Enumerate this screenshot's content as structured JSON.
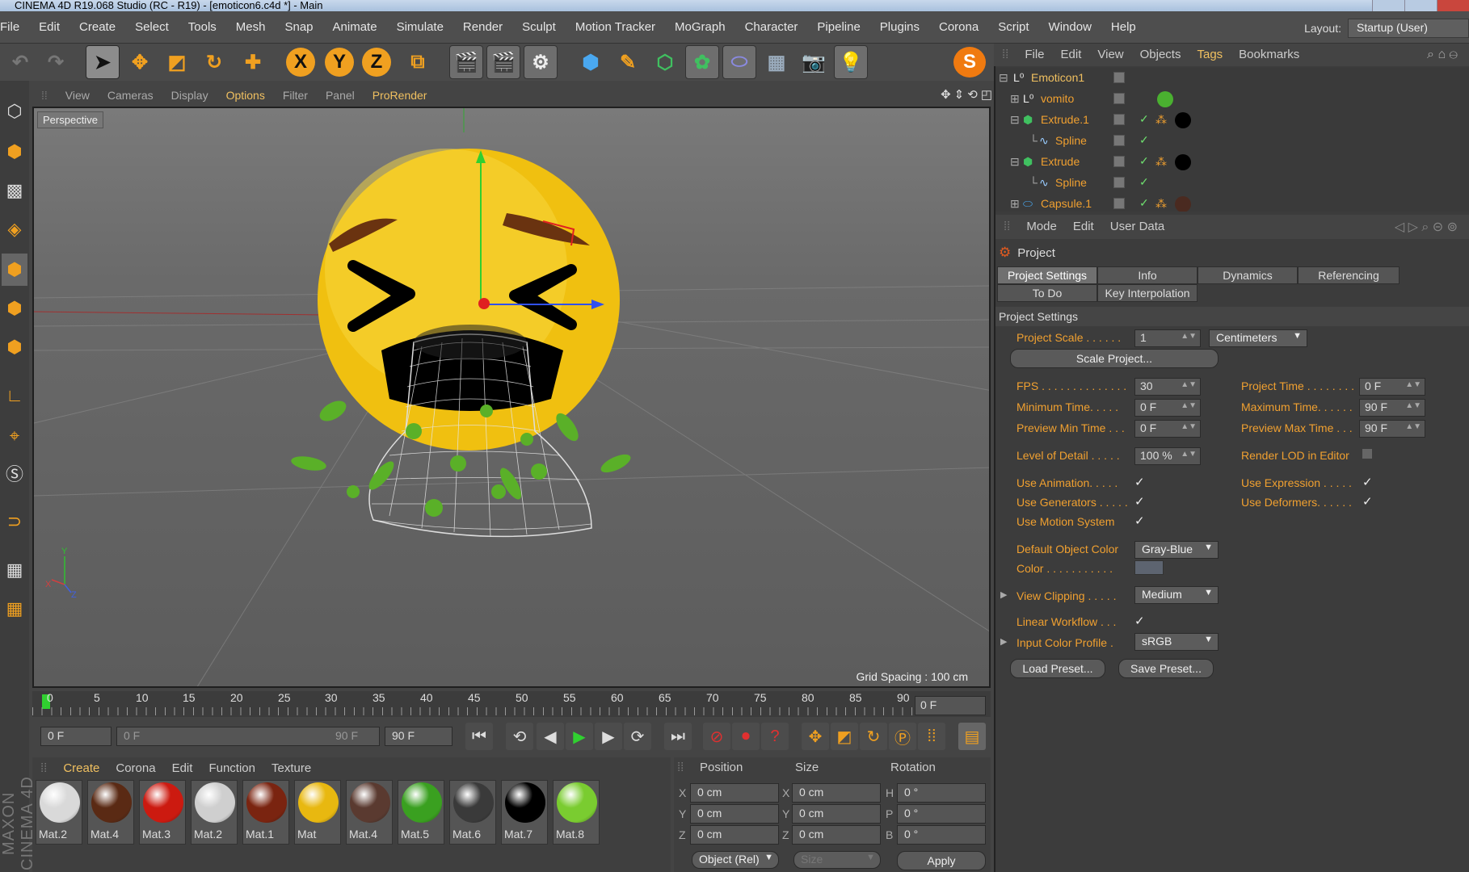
{
  "window": {
    "title": "CINEMA 4D R19.068 Studio (RC - R19) - [emoticon6.c4d *] - Main"
  },
  "menubar": {
    "items": [
      "File",
      "Edit",
      "Create",
      "Select",
      "Tools",
      "Mesh",
      "Snap",
      "Animate",
      "Simulate",
      "Render",
      "Sculpt",
      "Motion Tracker",
      "MoGraph",
      "Character",
      "Pipeline",
      "Plugins",
      "Corona",
      "Script",
      "Window",
      "Help"
    ]
  },
  "layout": {
    "label": "Layout:",
    "value": "Startup (User)"
  },
  "viewport": {
    "menu": [
      "View",
      "Cameras",
      "Display",
      "Options",
      "Filter",
      "Panel",
      "ProRender"
    ],
    "label": "Perspective",
    "grid_spacing": "Grid Spacing : 100 cm"
  },
  "timeline": {
    "ticks": [
      "0",
      "5",
      "10",
      "15",
      "20",
      "25",
      "30",
      "35",
      "40",
      "45",
      "50",
      "55",
      "60",
      "65",
      "70",
      "75",
      "80",
      "85",
      "90"
    ],
    "frame": "0 F"
  },
  "transport": {
    "start": "0 F",
    "range_start": "0 F",
    "range_end": "90 F",
    "end": "90 F"
  },
  "materials": {
    "menu": [
      "Create",
      "Corona",
      "Edit",
      "Function",
      "Texture"
    ],
    "items": [
      {
        "name": "Mat.2",
        "color": "#d9d9d9"
      },
      {
        "name": "Mat.4",
        "color": "#5a2a14"
      },
      {
        "name": "Mat.3",
        "color": "#cc1a10"
      },
      {
        "name": "Mat.2",
        "color": "#cfcfcf"
      },
      {
        "name": "Mat.1",
        "color": "#7a2410"
      },
      {
        "name": "Mat",
        "color": "#e8b810"
      },
      {
        "name": "Mat.4",
        "color": "#5a3a30"
      },
      {
        "name": "Mat.5",
        "color": "#3aa020"
      },
      {
        "name": "Mat.6",
        "color": "#3a3a3a"
      },
      {
        "name": "Mat.7",
        "color": "#000000"
      },
      {
        "name": "Mat.8",
        "color": "#7acc30"
      }
    ]
  },
  "coords": {
    "headers": [
      "Position",
      "Size",
      "Rotation"
    ],
    "rows": [
      {
        "axis": "X",
        "pos": "0 cm",
        "saxis": "X",
        "size": "0 cm",
        "raxis": "H",
        "rot": "0 °"
      },
      {
        "axis": "Y",
        "pos": "0 cm",
        "saxis": "Y",
        "size": "0 cm",
        "raxis": "P",
        "rot": "0 °"
      },
      {
        "axis": "Z",
        "pos": "0 cm",
        "saxis": "Z",
        "size": "0 cm",
        "raxis": "B",
        "rot": "0 °"
      }
    ],
    "mode": "Object (Rel)",
    "size_mode": "Size",
    "apply": "Apply"
  },
  "objects": {
    "menu": [
      "File",
      "Edit",
      "View",
      "Objects",
      "Tags",
      "Bookmarks"
    ],
    "rows": [
      {
        "name": "Emoticon1"
      },
      {
        "name": "vomito"
      },
      {
        "name": "Extrude.1"
      },
      {
        "name": "Spline"
      },
      {
        "name": "Extrude"
      },
      {
        "name": "Spline"
      },
      {
        "name": "Capsule.1"
      }
    ]
  },
  "attributes": {
    "menu": [
      "Mode",
      "Edit",
      "User Data"
    ],
    "header": "Project",
    "tabs_row1": [
      "Project Settings",
      "Info",
      "Dynamics",
      "Referencing"
    ],
    "tabs_row2": [
      "To Do",
      "Key Interpolation"
    ],
    "section": "Project Settings",
    "project_scale": {
      "label": "Project Scale . . . . . .",
      "value": "1",
      "unit": "Centimeters"
    },
    "scale_button": "Scale Project...",
    "fps": {
      "label": "FPS . . . . . . . . . . . . . .",
      "value": "30"
    },
    "project_time": {
      "label": "Project Time . . . . . . . .",
      "value": "0 F"
    },
    "min_time": {
      "label": "Minimum Time. . . . .",
      "value": "0 F"
    },
    "max_time": {
      "label": "Maximum Time. . . . . .",
      "value": "90 F"
    },
    "prev_min": {
      "label": "Preview Min Time . . .",
      "value": "0 F"
    },
    "prev_max": {
      "label": "Preview Max Time . . .",
      "value": "90 F"
    },
    "lod": {
      "label": "Level of Detail . . . . .",
      "value": "100 %"
    },
    "render_lod": {
      "label": "Render LOD in Editor"
    },
    "use_animation": {
      "label": "Use Animation. . . . ."
    },
    "use_expression": {
      "label": "Use Expression . . . . ."
    },
    "use_generators": {
      "label": "Use Generators . . . . ."
    },
    "use_deformers": {
      "label": "Use Deformers. . . . . ."
    },
    "use_motion": {
      "label": "Use Motion System"
    },
    "default_color": {
      "label": "Default Object Color",
      "value": "Gray-Blue"
    },
    "color": {
      "label": "Color . . . . . . . . . . ."
    },
    "view_clipping": {
      "label": "View Clipping . . . . .",
      "value": "Medium"
    },
    "linear_workflow": {
      "label": "Linear Workflow . . ."
    },
    "input_color": {
      "label": "Input Color Profile .",
      "value": "sRGB"
    },
    "load_preset": "Load Preset...",
    "save_preset": "Save Preset...",
    "check_mark": "✓"
  }
}
